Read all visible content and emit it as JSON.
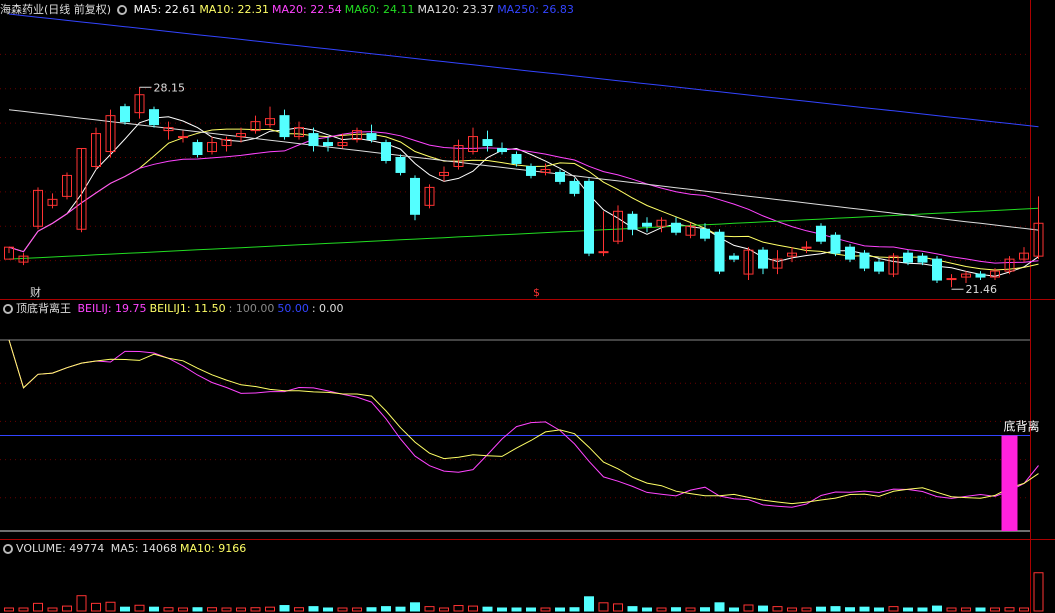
{
  "main": {
    "title": "海森药业(日线 前复权)",
    "ma": [
      {
        "label": "MA5: 22.61",
        "color": "#ffffff"
      },
      {
        "label": "MA10: 22.31",
        "color": "#ffff66"
      },
      {
        "label": "MA20: 22.54",
        "color": "#ff44ff"
      },
      {
        "label": "MA60: 24.11",
        "color": "#22dd22"
      },
      {
        "label": "MA120: 23.37",
        "color": "#dddddd"
      },
      {
        "label": "MA250: 26.83",
        "color": "#3344ff"
      }
    ],
    "high_label": "28.15",
    "low_label": "21.46",
    "marker_cai": "财",
    "marker_s": "$"
  },
  "indicator": {
    "title": "顶底背离王",
    "items": [
      {
        "label": "BEILIJ: 19.75",
        "color": "#ff44ff"
      },
      {
        "label": "BEILIJ1: 11.50",
        "color": "#ffff66"
      },
      {
        "label": ": 100.00",
        "color": "#888888"
      },
      {
        "label": "50.00",
        "color": "#3344ff"
      },
      {
        "label": ": 0.00",
        "color": "#dddddd"
      }
    ],
    "signal_label": "底背离"
  },
  "volume": {
    "title": "VOLUME: 49774",
    "items": [
      {
        "label": "MA5: 14068",
        "color": "#dddddd"
      },
      {
        "label": "MA10: 9166",
        "color": "#ffff66"
      }
    ]
  },
  "chart_data": {
    "type": "candlestick",
    "up_color": "#ff3333",
    "down_color": "#54ffff",
    "candles": [
      [
        22.4,
        22.8,
        22.6,
        22.8
      ],
      [
        22.3,
        22.5,
        22.2,
        22.6
      ],
      [
        23.5,
        24.7,
        23.4,
        24.8
      ],
      [
        24.2,
        24.4,
        24.1,
        24.6
      ],
      [
        24.5,
        25.2,
        24.4,
        25.3
      ],
      [
        23.4,
        26.1,
        23.3,
        26.1
      ],
      [
        25.5,
        26.6,
        25.4,
        26.8
      ],
      [
        26.0,
        27.2,
        25.8,
        27.4
      ],
      [
        27.5,
        27.0,
        26.9,
        27.6
      ],
      [
        27.3,
        27.9,
        27.1,
        28.15
      ],
      [
        27.4,
        26.9,
        26.8,
        27.5
      ],
      [
        26.7,
        26.8,
        26.4,
        27.0
      ],
      [
        26.5,
        26.5,
        26.3,
        26.7
      ],
      [
        26.3,
        25.9,
        25.8,
        26.4
      ],
      [
        26.0,
        26.3,
        25.9,
        26.5
      ],
      [
        26.2,
        26.4,
        26.0,
        26.5
      ],
      [
        26.5,
        26.6,
        26.3,
        26.8
      ],
      [
        26.7,
        27.0,
        26.6,
        27.2
      ],
      [
        26.9,
        27.1,
        26.8,
        27.5
      ],
      [
        27.2,
        26.5,
        26.4,
        27.4
      ],
      [
        26.5,
        26.8,
        26.4,
        27.0
      ],
      [
        26.6,
        26.2,
        26.0,
        26.8
      ],
      [
        26.3,
        26.2,
        26.0,
        26.5
      ],
      [
        26.2,
        26.3,
        26.1,
        26.6
      ],
      [
        26.4,
        26.7,
        26.3,
        26.8
      ],
      [
        26.6,
        26.4,
        26.3,
        26.9
      ],
      [
        26.3,
        25.7,
        25.6,
        26.4
      ],
      [
        25.8,
        25.3,
        25.2,
        25.9
      ],
      [
        25.1,
        23.9,
        23.7,
        25.2
      ],
      [
        24.2,
        24.8,
        24.1,
        24.9
      ],
      [
        25.2,
        25.3,
        25.0,
        25.5
      ],
      [
        25.5,
        26.2,
        25.4,
        26.4
      ],
      [
        26.0,
        26.5,
        25.9,
        26.8
      ],
      [
        26.4,
        26.2,
        26.0,
        26.7
      ],
      [
        26.1,
        26.0,
        25.9,
        26.3
      ],
      [
        25.9,
        25.6,
        25.5,
        26.0
      ],
      [
        25.5,
        25.2,
        25.1,
        25.6
      ],
      [
        25.3,
        25.4,
        25.2,
        25.6
      ],
      [
        25.3,
        25.0,
        24.9,
        25.4
      ],
      [
        25.0,
        24.6,
        24.5,
        25.1
      ],
      [
        25.0,
        22.6,
        22.5,
        25.1
      ],
      [
        22.65,
        22.65,
        22.5,
        24.0
      ],
      [
        23.0,
        24.0,
        22.9,
        24.2
      ],
      [
        23.9,
        23.4,
        23.2,
        24.0
      ],
      [
        23.6,
        23.5,
        23.3,
        23.8
      ],
      [
        23.5,
        23.7,
        23.3,
        23.8
      ],
      [
        23.6,
        23.3,
        23.2,
        23.8
      ],
      [
        23.2,
        23.5,
        23.1,
        23.6
      ],
      [
        23.4,
        23.1,
        23.0,
        23.6
      ],
      [
        23.3,
        22.0,
        21.9,
        23.4
      ],
      [
        22.5,
        22.4,
        22.3,
        22.6
      ],
      [
        21.9,
        22.7,
        21.7,
        22.8
      ],
      [
        22.7,
        22.1,
        21.9,
        22.8
      ],
      [
        22.1,
        22.4,
        21.9,
        22.7
      ],
      [
        22.5,
        22.6,
        22.3,
        22.8
      ],
      [
        22.8,
        22.8,
        22.6,
        23.0
      ],
      [
        23.5,
        23.0,
        22.9,
        23.6
      ],
      [
        23.2,
        22.6,
        22.5,
        23.3
      ],
      [
        22.8,
        22.4,
        22.3,
        22.9
      ],
      [
        22.6,
        22.1,
        22.0,
        22.7
      ],
      [
        22.3,
        22.0,
        21.9,
        22.4
      ],
      [
        21.9,
        22.5,
        21.8,
        22.6
      ],
      [
        22.6,
        22.3,
        22.2,
        22.7
      ],
      [
        22.5,
        22.3,
        22.2,
        22.6
      ],
      [
        22.4,
        21.7,
        21.6,
        22.5
      ],
      [
        21.75,
        21.75,
        21.46,
        21.9
      ],
      [
        21.8,
        21.9,
        21.6,
        22.0
      ],
      [
        21.9,
        21.8,
        21.7,
        22.0
      ],
      [
        21.8,
        22.0,
        21.7,
        22.1
      ],
      [
        22.0,
        22.4,
        21.9,
        22.5
      ],
      [
        22.4,
        22.6,
        22.3,
        22.8
      ],
      [
        22.5,
        23.6,
        22.4,
        24.5
      ]
    ],
    "indicator_range": [
      0,
      100
    ],
    "indicator_levels": [
      0,
      50,
      100
    ],
    "signal_value": 50,
    "ma_colors": [
      "#ffffff",
      "#ffff66",
      "#ff44ff",
      "#22dd22",
      "#dddddd",
      "#3344ff"
    ]
  }
}
